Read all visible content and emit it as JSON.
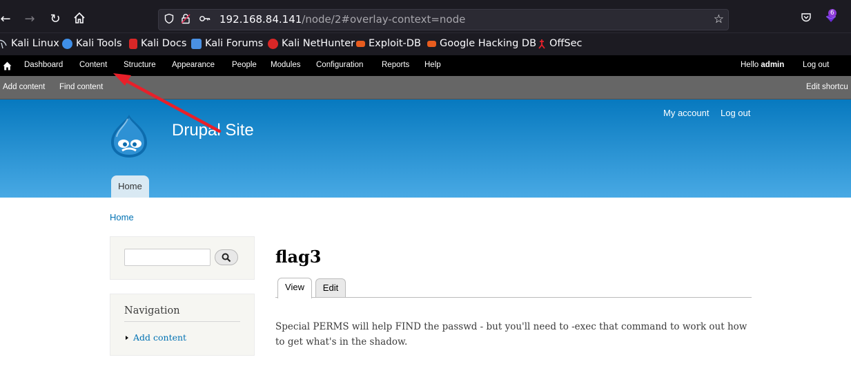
{
  "browser": {
    "url_host": "192.168.84.141",
    "url_path": "/node/2#overlay-context=node",
    "extensions_badge": "6",
    "bookmarks": [
      {
        "label": "Kali Linux",
        "color": "#367bf0"
      },
      {
        "label": "Kali Tools",
        "color": "#3f8fe8"
      },
      {
        "label": "Kali Docs",
        "color": "#d92727"
      },
      {
        "label": "Kali Forums",
        "color": "#4a90e2"
      },
      {
        "label": "Kali NetHunter",
        "color": "#d92727"
      },
      {
        "label": "Exploit-DB",
        "color": "#e85c1e"
      },
      {
        "label": "Google Hacking DB",
        "color": "#e85c1e"
      },
      {
        "label": "OffSec",
        "color": "#d92727"
      }
    ]
  },
  "toolbar": {
    "items": [
      "Dashboard",
      "Content",
      "Structure",
      "Appearance",
      "People",
      "Modules",
      "Configuration",
      "Reports",
      "Help"
    ],
    "hello_prefix": "Hello ",
    "hello_user": "admin",
    "logout": "Log out"
  },
  "shortcuts": {
    "items": [
      "Add content",
      "Find content"
    ],
    "edit": "Edit shortcu"
  },
  "header": {
    "site_name": "Drupal Site",
    "my_account": "My account",
    "log_out": "Log out",
    "home_tab": "Home"
  },
  "breadcrumb": "Home",
  "sidebar": {
    "search_value": "",
    "navigation_title": "Navigation",
    "nav_items": [
      "Add content"
    ]
  },
  "node": {
    "title": "flag3",
    "tabs": [
      "View",
      "Edit"
    ],
    "body": "Special PERMS will help FIND the passwd - but you'll need to -exec that command to work out how to get what's in the shadow."
  },
  "colors": {
    "header_top": "#0779bf",
    "header_bottom": "#48a9e4",
    "link": "#0071b3",
    "annotation_arrow": "#e8202a"
  }
}
